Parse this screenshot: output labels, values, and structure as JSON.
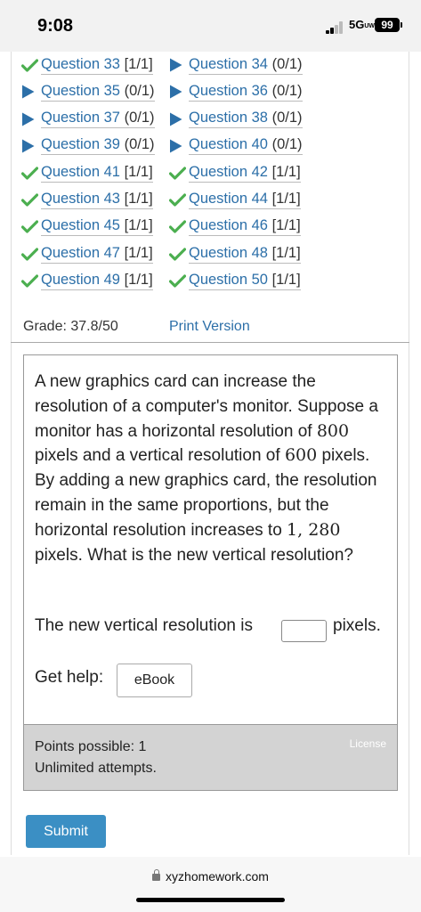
{
  "status_bar": {
    "time": "9:08",
    "network": "5G",
    "network_suffix": "UW",
    "battery": "99"
  },
  "questions": [
    {
      "left": {
        "label": "Question 33",
        "status": "[1/1]",
        "icon": "checkmark-icon"
      },
      "right": {
        "label": "Question 34",
        "status": "(0/1)",
        "icon": "play-arrow-icon"
      }
    },
    {
      "left": {
        "label": "Question 35",
        "status": "(0/1)",
        "icon": "play-arrow-icon"
      },
      "right": {
        "label": "Question 36",
        "status": "(0/1)",
        "icon": "play-arrow-icon"
      }
    },
    {
      "left": {
        "label": "Question 37",
        "status": "(0/1)",
        "icon": "play-arrow-icon"
      },
      "right": {
        "label": "Question 38",
        "status": "(0/1)",
        "icon": "play-arrow-icon"
      }
    },
    {
      "left": {
        "label": "Question 39",
        "status": "(0/1)",
        "icon": "play-arrow-icon"
      },
      "right": {
        "label": "Question 40",
        "status": "(0/1)",
        "icon": "play-arrow-icon"
      }
    },
    {
      "left": {
        "label": "Question 41",
        "status": "[1/1]",
        "icon": "checkmark-icon"
      },
      "right": {
        "label": "Question 42",
        "status": "[1/1]",
        "icon": "checkmark-icon"
      }
    },
    {
      "left": {
        "label": "Question 43",
        "status": "[1/1]",
        "icon": "checkmark-icon"
      },
      "right": {
        "label": "Question 44",
        "status": "[1/1]",
        "icon": "checkmark-icon"
      }
    },
    {
      "left": {
        "label": "Question 45",
        "status": "[1/1]",
        "icon": "checkmark-icon"
      },
      "right": {
        "label": "Question 46",
        "status": "[1/1]",
        "icon": "checkmark-icon"
      }
    },
    {
      "left": {
        "label": "Question 47",
        "status": "[1/1]",
        "icon": "checkmark-icon"
      },
      "right": {
        "label": "Question 48",
        "status": "[1/1]",
        "icon": "checkmark-icon"
      }
    },
    {
      "left": {
        "label": "Question 49",
        "status": "[1/1]",
        "icon": "checkmark-icon"
      },
      "right": {
        "label": "Question 50",
        "status": "[1/1]",
        "icon": "checkmark-icon"
      }
    }
  ],
  "grade": "Grade: 37.8/50",
  "print_version": "Print Version",
  "question": {
    "text_1": "A new graphics card can increase the resolution of a computer's monitor. Suppose a monitor has a horizontal resolution of ",
    "num_1": "800",
    "text_2": " pixels and a vertical resolution of ",
    "num_2": "600",
    "text_3": " pixels. By adding a new graphics card, the resolution remain in the same proportions, but the horizontal resolution increases to ",
    "num_3": "1, 280",
    "text_4": " pixels. What is the new vertical resolution?",
    "answer_prefix": "The new vertical resolution is",
    "answer_value": "",
    "answer_unit": "pixels.",
    "help_label": "Get help:",
    "ebook": "eBook"
  },
  "points": {
    "possible": "Points possible: 1",
    "attempts": "Unlimited attempts.",
    "license": "License"
  },
  "submit": "Submit",
  "url": "xyzhomework.com",
  "colors": {
    "link": "#2c6fa8",
    "check": "#4caf50",
    "arrow": "#2c6fa8",
    "submit": "#3b8fc4",
    "points_bg": "#d3d3d3"
  }
}
